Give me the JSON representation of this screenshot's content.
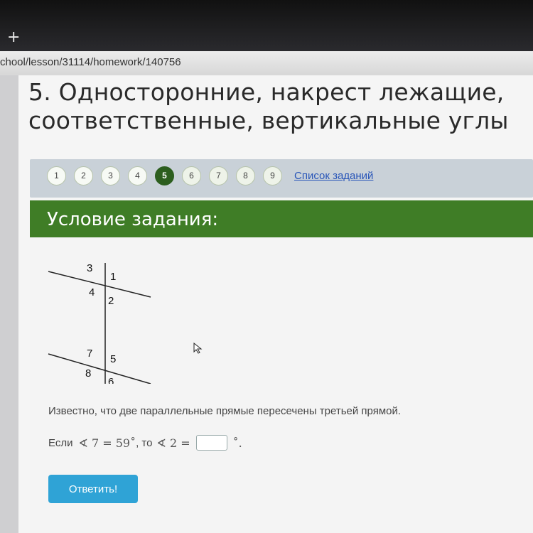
{
  "browser": {
    "new_tab_symbol": "+",
    "url": "chool/lesson/31114/homework/140756"
  },
  "lesson": {
    "title_line1": "5. Односторонние, накрест лежащие,",
    "title_line2": "соответственные, вертикальные углы"
  },
  "navigation": {
    "pages": [
      "1",
      "2",
      "3",
      "4",
      "5",
      "6",
      "7",
      "8",
      "9"
    ],
    "task_list_label": "Список заданий"
  },
  "task": {
    "header": "Условие задания:",
    "figure_labels": [
      "3",
      "1",
      "4",
      "2",
      "7",
      "5",
      "8",
      "6"
    ],
    "statement": "Известно, что две параллельные прямые пересечены третьей прямой.",
    "question_prefix": "Если",
    "angle_given": "∢ 7 = 59˚",
    "question_middle": ", то",
    "angle_asked": "∢ 2 =",
    "answer_value": "",
    "degree_suffix": "˚.",
    "submit_label": "Ответить!"
  }
}
